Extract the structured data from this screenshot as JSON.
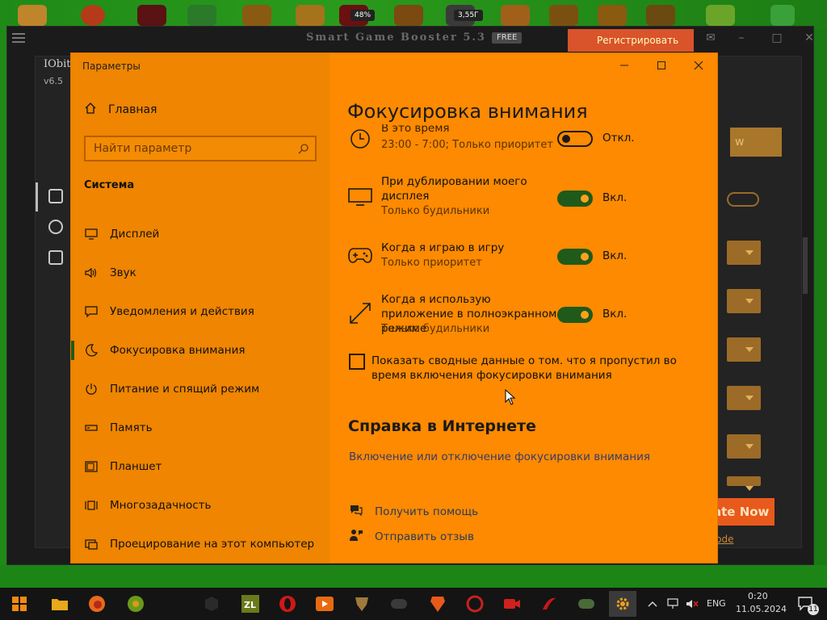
{
  "desktop": {
    "top_badges": [
      "48%",
      "3,55Г"
    ]
  },
  "booster": {
    "title": "Smart Game Booster 5.3",
    "free_badge": "FREE",
    "register_button": "Регистрировать",
    "brand": "IObit",
    "version": "v6.5",
    "right_button": "w",
    "close_x": "x",
    "rate_button": "ate Now",
    "code_link": "r Code"
  },
  "settings": {
    "window_title": "Параметры",
    "home_label": "Главная",
    "search_placeholder": "Найти параметр",
    "section_label": "Система",
    "nav_items": [
      {
        "label": "Дисплей",
        "icon": "display-icon"
      },
      {
        "label": "Звук",
        "icon": "speaker-icon"
      },
      {
        "label": "Уведомления и действия",
        "icon": "notification-icon"
      },
      {
        "label": "Фокусировка внимания",
        "icon": "moon-icon",
        "active": true
      },
      {
        "label": "Питание и спящий режим",
        "icon": "power-icon"
      },
      {
        "label": "Память",
        "icon": "storage-icon"
      },
      {
        "label": "Планшет",
        "icon": "tablet-icon"
      },
      {
        "label": "Многозадачность",
        "icon": "multitask-icon"
      },
      {
        "label": "Проецирование на этот компьютер",
        "icon": "project-icon"
      }
    ],
    "page_heading": "Фокусировка внимания",
    "rules": [
      {
        "title": "В это время",
        "subtitle": "23:00 - 7:00; Только приоритет",
        "state": "off",
        "state_label": "Откл.",
        "icon": "clock-icon"
      },
      {
        "title": "При дублировании моего дисплея",
        "subtitle": "Только будильники",
        "state": "on",
        "state_label": "Вкл.",
        "icon": "monitor-icon"
      },
      {
        "title": "Когда я играю в игру",
        "subtitle": "Только приоритет",
        "state": "on",
        "state_label": "Вкл.",
        "icon": "gamepad-icon"
      },
      {
        "title": "Когда я использую приложение в полноэкранном режиме",
        "subtitle": "Только будильники",
        "state": "on",
        "state_label": "Вкл.",
        "icon": "fullscreen-icon"
      }
    ],
    "summary_checkbox_label": "Показать сводные данные о том. что я пропустил во время включения фокусировки внимания",
    "help_heading": "Справка в Интернете",
    "help_link": "Включение или отключение фокусировки внимания",
    "get_help": "Получить помощь",
    "send_feedback": "Отправить отзыв"
  },
  "taskbar": {
    "language": "ENG",
    "time": "0:20",
    "date": "11.05.2024",
    "notification_count": "11"
  },
  "colors": {
    "settings_bg": "#fd8a00",
    "settings_sidebar": "#ef8500",
    "toggle_on": "#1f5a1a",
    "desktop_green": "#1a7a14"
  }
}
